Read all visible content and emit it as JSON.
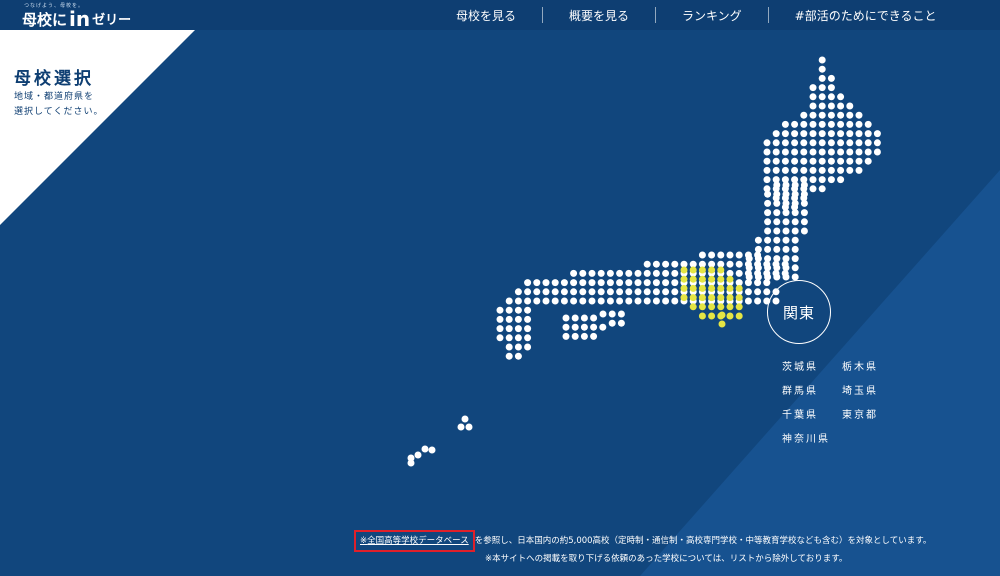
{
  "brand": {
    "tagline": "つなげよう、母校を。",
    "name_main": "母校に",
    "name_in": "in",
    "name_jelly": "ゼリー"
  },
  "nav": {
    "items": [
      {
        "label": "母校を見る"
      },
      {
        "label": "概要を見る"
      },
      {
        "label": "ランキング"
      },
      {
        "label": "#部活のためにできること"
      }
    ]
  },
  "panel": {
    "title": "母校選択",
    "subtitle_line1": "地域・都道府県を",
    "subtitle_line2": "選択してください。"
  },
  "region": {
    "name": "関東",
    "prefectures": [
      "茨城県",
      "栃木県",
      "群馬県",
      "埼玉県",
      "千葉県",
      "東京都",
      "神奈川県"
    ]
  },
  "footnote": {
    "prefix": "※",
    "link": "全国高等学校データベース",
    "line1_rest": "を参照し、日本国内の約5,000高校（定時制・通信制・高校専門学校・中等教育学校なども含む）を対象としています。",
    "line2": "※本サイトへの掲載を取り下げる依頼のあった学校については、リストから除外しております。"
  },
  "colors": {
    "background": "#11467d",
    "topbar": "#0e3e72",
    "light_band": "#1d5da0",
    "dot": "#ffffff",
    "highlight": "#e5e544",
    "link_box": "#e0202a"
  }
}
